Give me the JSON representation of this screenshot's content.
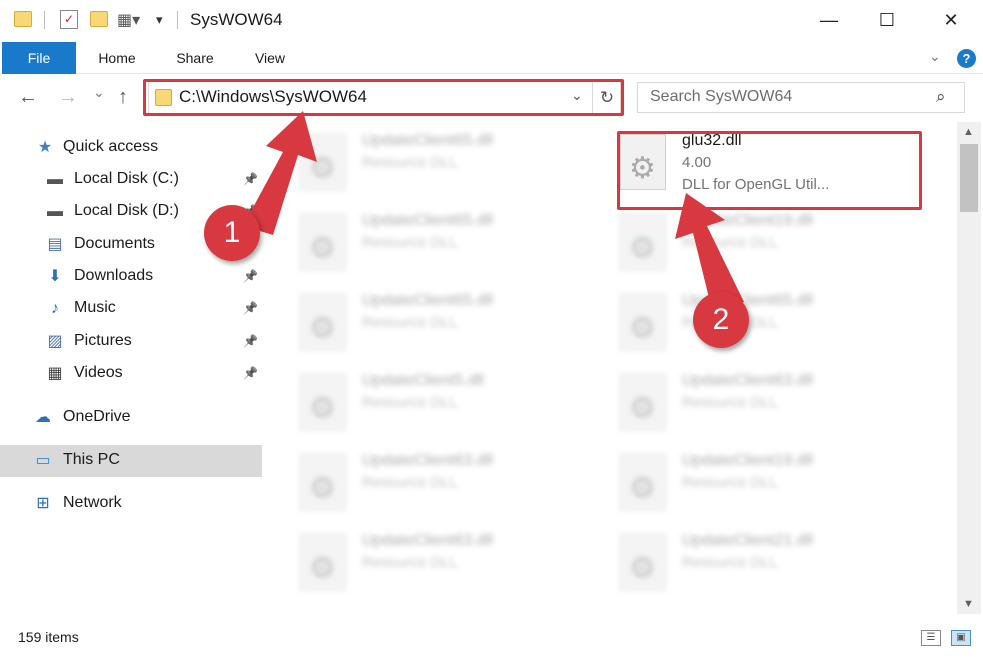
{
  "window": {
    "title": "SysWOW64",
    "minimize_glyph": "—",
    "maximize_glyph": "☐",
    "close_glyph": "✕"
  },
  "ribbon": {
    "tabs": [
      "File",
      "Home",
      "Share",
      "View"
    ],
    "help_glyph": "?"
  },
  "navigation": {
    "back_glyph": "←",
    "forward_glyph": "→",
    "recent_glyph": "⌄",
    "up_glyph": "↑",
    "address": "C:\\Windows\\SysWOW64",
    "refresh_glyph": "↻",
    "search_placeholder": "Search SysWOW64"
  },
  "sidebar": {
    "items": [
      {
        "label": "Quick access",
        "icon": "star-icon",
        "glyph": "★",
        "color": "#3c7fc4",
        "pinned": false
      },
      {
        "label": "Local Disk (C:)",
        "icon": "drive-icon",
        "glyph": "▬",
        "color": "#555555",
        "pinned": true
      },
      {
        "label": "Local Disk (D:)",
        "icon": "drive-icon",
        "glyph": "▬",
        "color": "#555555",
        "pinned": true
      },
      {
        "label": "Documents",
        "icon": "documents-icon",
        "glyph": "▤",
        "color": "#4a6fa5",
        "pinned": true
      },
      {
        "label": "Downloads",
        "icon": "download-arrow-icon",
        "glyph": "⬇",
        "color": "#2f6fb5",
        "pinned": true
      },
      {
        "label": "Music",
        "icon": "music-note-icon",
        "glyph": "♪",
        "color": "#2f6fb5",
        "pinned": true
      },
      {
        "label": "Pictures",
        "icon": "pictures-icon",
        "glyph": "▨",
        "color": "#4a6fa5",
        "pinned": true
      },
      {
        "label": "Videos",
        "icon": "film-icon",
        "glyph": "▦",
        "color": "#444444",
        "pinned": true
      },
      {
        "label": "OneDrive",
        "icon": "cloud-icon",
        "glyph": "☁",
        "color": "#2f6fb5",
        "pinned": false
      },
      {
        "label": "This PC",
        "icon": "computer-icon",
        "glyph": "▭",
        "color": "#2f8ad8",
        "pinned": false
      },
      {
        "label": "Network",
        "icon": "network-icon",
        "glyph": "⊞",
        "color": "#2f6fb5",
        "pinned": false
      }
    ]
  },
  "files": [
    {
      "name": "UpdateClient65.dll",
      "type": "Resource DLL"
    },
    {
      "name": "glu32.dll",
      "version": "4.00",
      "description": "DLL for OpenGL Util..."
    },
    {
      "name": "UpdateClient65.dll",
      "type": "Resource DLL"
    },
    {
      "name": "UpdateClient19.dll",
      "type": "Resource DLL"
    },
    {
      "name": "UpdateClient65.dll",
      "type": "Resource DLL"
    },
    {
      "name": "UpdateClient65.dll",
      "type": "Resource DLL"
    },
    {
      "name": "UpdateClient5.dll",
      "type": "Resource DLL"
    },
    {
      "name": "UpdateClient63.dll",
      "type": "Resource DLL"
    },
    {
      "name": "UpdateClient63.dll",
      "type": "Resource DLL"
    },
    {
      "name": "UpdateClient19.dll",
      "type": "Resource DLL"
    },
    {
      "name": "UpdateClient63.dll",
      "type": "Resource DLL"
    },
    {
      "name": "UpdateClient21.dll",
      "type": "Resource DLL"
    }
  ],
  "status": {
    "item_count": "159 items"
  },
  "callouts": [
    {
      "number": "1",
      "color": "#d8383f"
    },
    {
      "number": "2",
      "color": "#d8383f"
    }
  ],
  "colors": {
    "accent": "#1979ca",
    "highlight_red": "#d8383f",
    "selected_nav": "#d9d9d9"
  }
}
